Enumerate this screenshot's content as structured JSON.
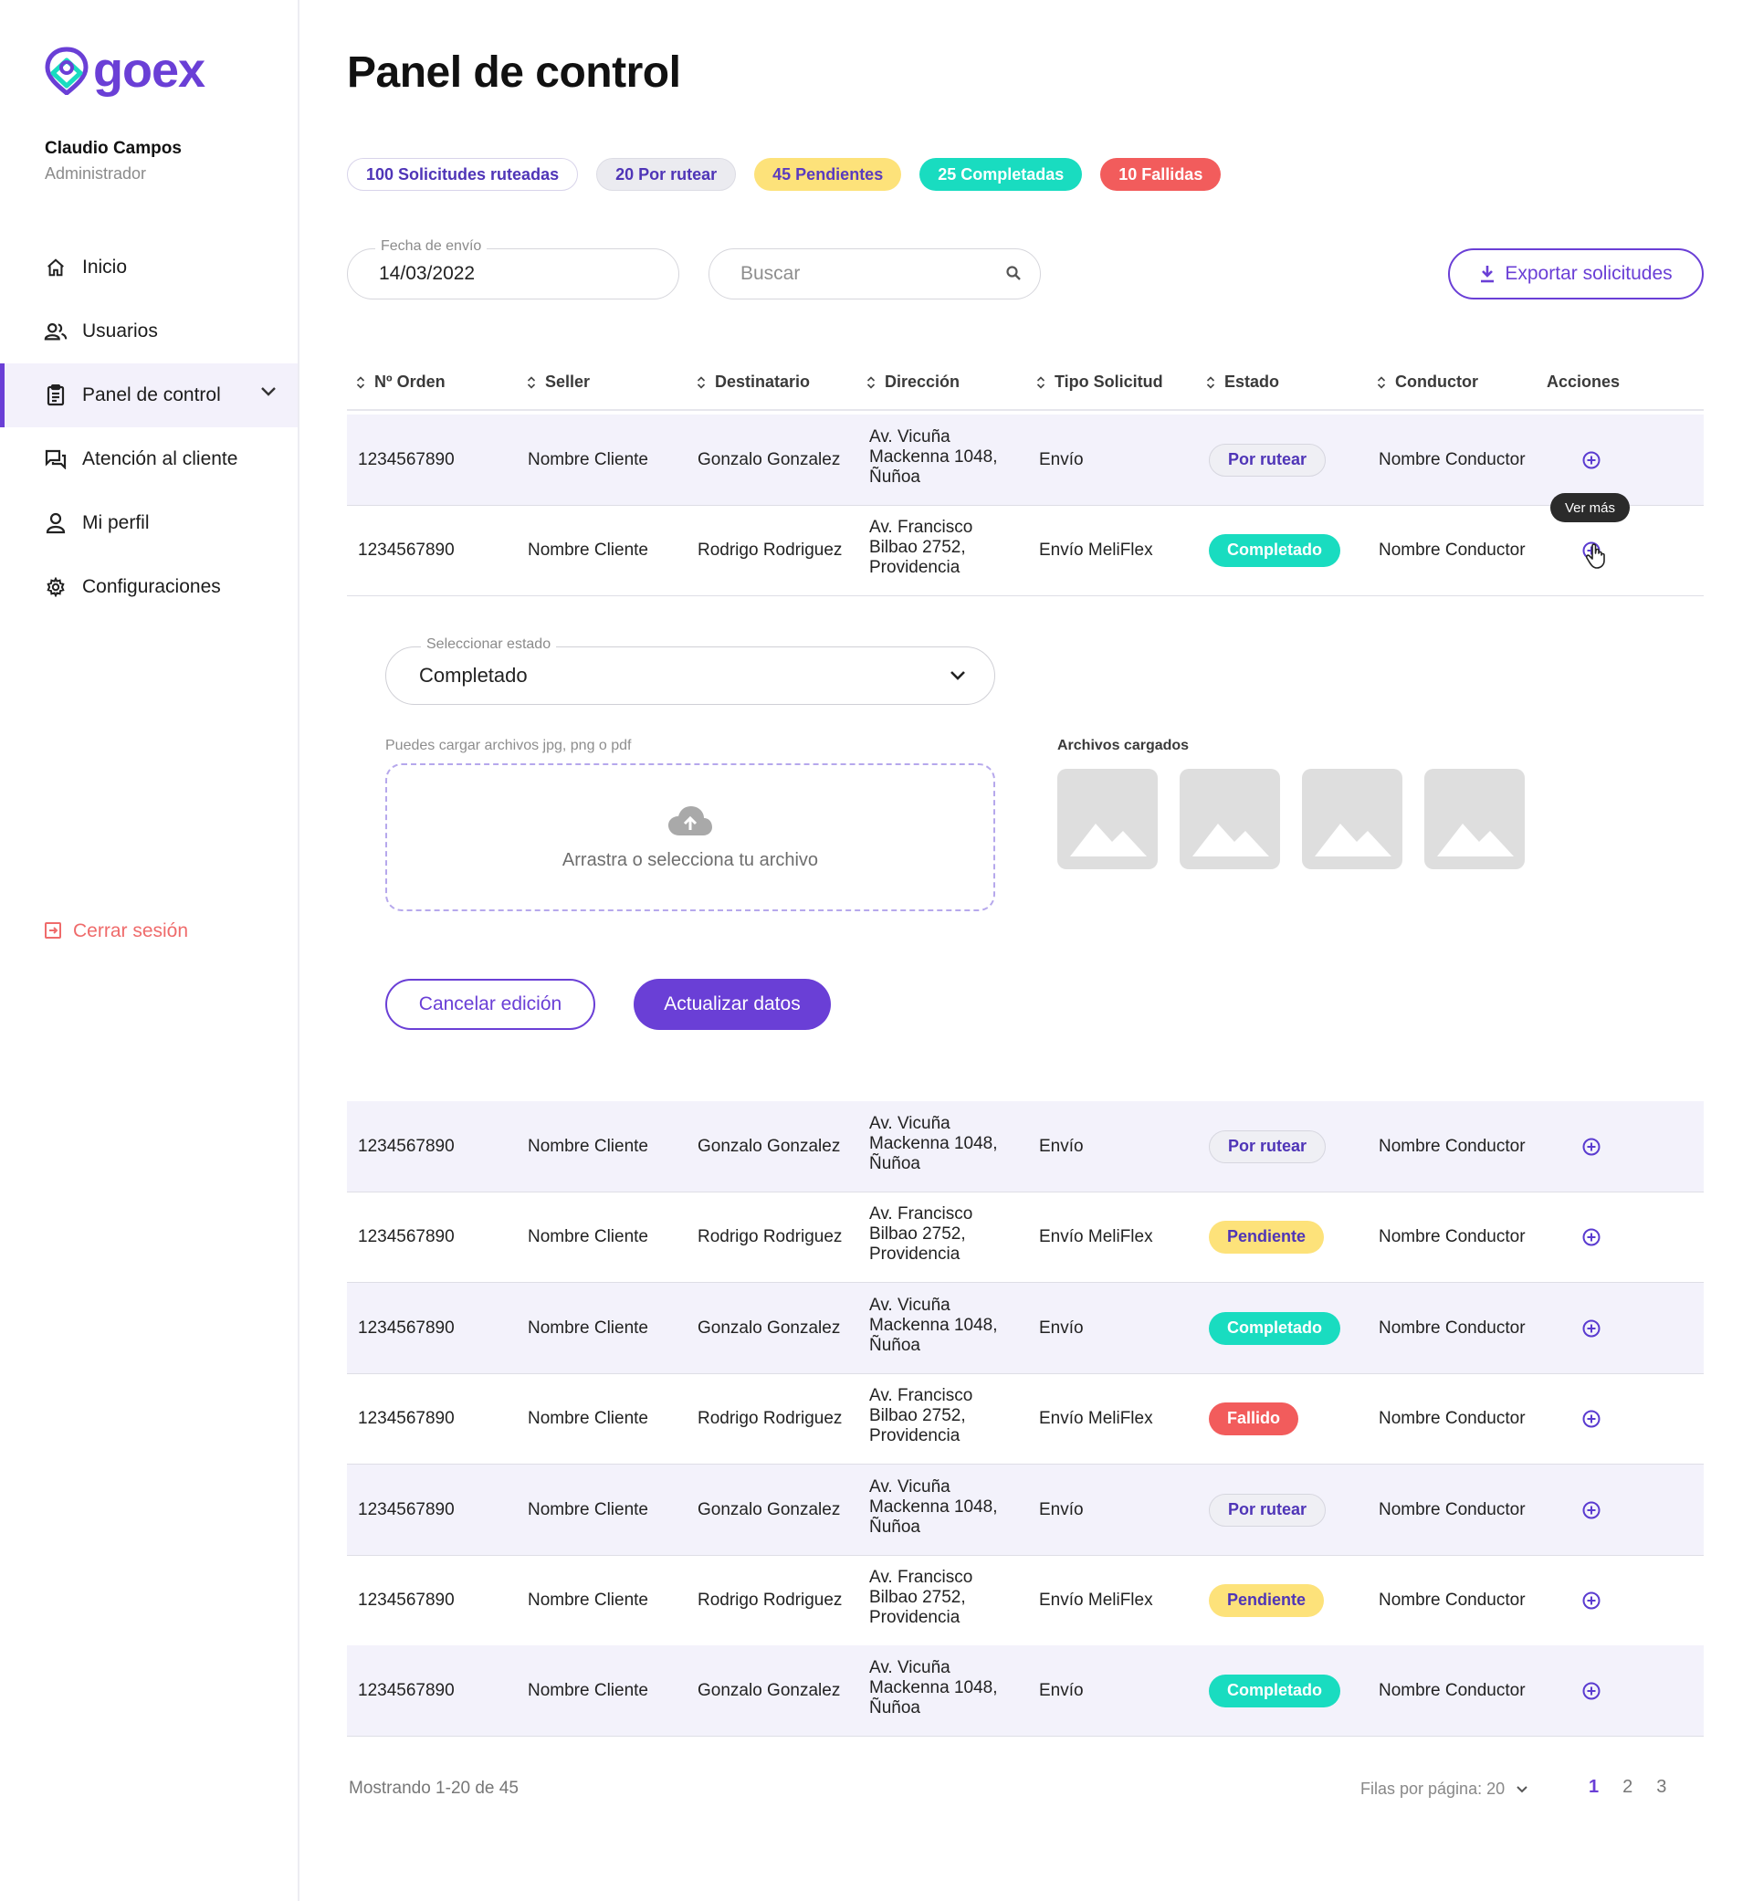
{
  "brand": {
    "name": "goex",
    "accent": "#6a3fd6",
    "teal": "#19dcc0"
  },
  "user": {
    "name": "Claudio Campos",
    "role": "Administrador"
  },
  "nav": [
    {
      "label": "Inicio",
      "icon": "home-icon"
    },
    {
      "label": "Usuarios",
      "icon": "users-icon"
    },
    {
      "label": "Panel de control",
      "icon": "clipboard-icon",
      "active": true
    },
    {
      "label": "Atención al cliente",
      "icon": "chat-icon"
    },
    {
      "label": "Mi perfil",
      "icon": "user-icon"
    },
    {
      "label": "Configuraciones",
      "icon": "gear-icon"
    }
  ],
  "logout": "Cerrar sesión",
  "page_title": "Panel de control",
  "summary_chips": [
    "100 Solicitudes ruteadas",
    "20 Por rutear",
    "45 Pendientes",
    "25 Completadas",
    "10 Fallidas"
  ],
  "filters": {
    "date_label": "Fecha de envío",
    "date_value": "14/03/2022",
    "search_placeholder": "Buscar",
    "export_label": "Exportar solicitudes"
  },
  "table": {
    "headers": [
      "Nº Orden",
      "Seller",
      "Destinatario",
      "Dirección",
      "Tipo Solicitud",
      "Estado",
      "Conductor",
      "Acciones"
    ],
    "rows": [
      {
        "orden": "1234567890",
        "seller": "Nombre Cliente",
        "destinatario": "Gonzalo Gonzalez",
        "direccion": [
          "Av. Vicuña",
          "Mackenna 1048,",
          "Ñuñoa"
        ],
        "tipo": "Envío",
        "estado": "Por rutear",
        "conductor": "Nombre Conductor"
      },
      {
        "orden": "1234567890",
        "seller": "Nombre Cliente",
        "destinatario": "Rodrigo Rodriguez",
        "direccion": [
          "Av. Francisco",
          "Bilbao 2752,",
          "Providencia"
        ],
        "tipo": "Envío MeliFlex",
        "estado": "Completado",
        "conductor": "Nombre Conductor"
      },
      {
        "orden": "1234567890",
        "seller": "Nombre Cliente",
        "destinatario": "Gonzalo Gonzalez",
        "direccion": [
          "Av. Vicuña",
          "Mackenna 1048,",
          "Ñuñoa"
        ],
        "tipo": "Envío",
        "estado": "Por rutear",
        "conductor": "Nombre Conductor"
      },
      {
        "orden": "1234567890",
        "seller": "Nombre Cliente",
        "destinatario": "Rodrigo Rodriguez",
        "direccion": [
          "Av. Francisco",
          "Bilbao 2752,",
          "Providencia"
        ],
        "tipo": "Envío MeliFlex",
        "estado": "Pendiente",
        "conductor": "Nombre Conductor"
      },
      {
        "orden": "1234567890",
        "seller": "Nombre Cliente",
        "destinatario": "Gonzalo Gonzalez",
        "direccion": [
          "Av. Vicuña",
          "Mackenna 1048,",
          "Ñuñoa"
        ],
        "tipo": "Envío",
        "estado": "Completado",
        "conductor": "Nombre Conductor"
      },
      {
        "orden": "1234567890",
        "seller": "Nombre Cliente",
        "destinatario": "Rodrigo Rodriguez",
        "direccion": [
          "Av. Francisco",
          "Bilbao 2752,",
          "Providencia"
        ],
        "tipo": "Envío MeliFlex",
        "estado": "Fallido",
        "conductor": "Nombre Conductor"
      },
      {
        "orden": "1234567890",
        "seller": "Nombre Cliente",
        "destinatario": "Gonzalo Gonzalez",
        "direccion": [
          "Av. Vicuña",
          "Mackenna 1048,",
          "Ñuñoa"
        ],
        "tipo": "Envío",
        "estado": "Por rutear",
        "conductor": "Nombre Conductor"
      },
      {
        "orden": "1234567890",
        "seller": "Nombre Cliente",
        "destinatario": "Rodrigo Rodriguez",
        "direccion": [
          "Av. Francisco",
          "Bilbao 2752,",
          "Providencia"
        ],
        "tipo": "Envío MeliFlex",
        "estado": "Pendiente",
        "conductor": "Nombre Conductor"
      },
      {
        "orden": "1234567890",
        "seller": "Nombre Cliente",
        "destinatario": "Gonzalo Gonzalez",
        "direccion": [
          "Av. Vicuña",
          "Mackenna 1048,",
          "Ñuñoa"
        ],
        "tipo": "Envío",
        "estado": "Completado",
        "conductor": "Nombre Conductor"
      }
    ]
  },
  "tooltip": "Ver más",
  "expand": {
    "select_label": "Seleccionar estado",
    "select_value": "Completado",
    "upload_hint": "Puedes cargar archivos jpg, png o pdf",
    "dropzone_text": "Arrastra o selecciona tu archivo",
    "files_title": "Archivos cargados",
    "cancel_label": "Cancelar edición",
    "update_label": "Actualizar datos"
  },
  "pagination": {
    "showing": "Mostrando 1-20 de 45",
    "rows_per_page": "Filas por página: 20",
    "pages": [
      "1",
      "2",
      "3"
    ],
    "current": "1"
  }
}
